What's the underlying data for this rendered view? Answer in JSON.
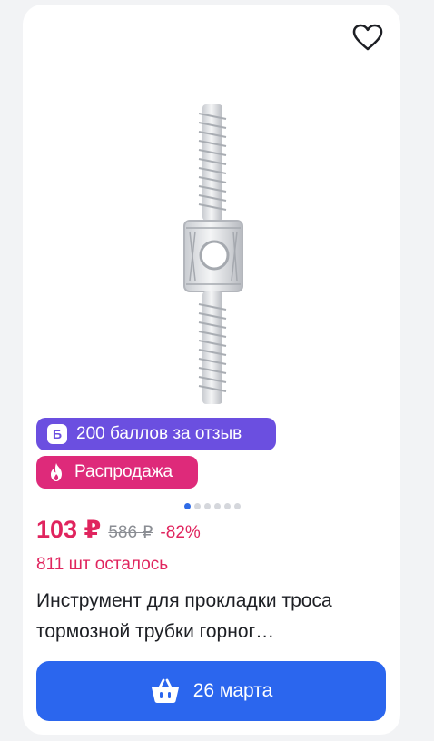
{
  "card": {
    "badges": {
      "points_icon": "Б",
      "points_label": "200 баллов за отзыв",
      "sale_label": "Распродажа"
    },
    "gallery": {
      "total_images": 6,
      "active_index": 0
    },
    "price": {
      "current": "103 ₽",
      "old": "586 ₽",
      "discount": "-82%"
    },
    "stock": "811 шт осталось",
    "title": "Инструмент для прокладки троса тормозной трубки горног…",
    "delivery_button": {
      "label": "26 марта"
    },
    "icons": [
      "heart-icon",
      "basket-icon",
      "fire-icon"
    ],
    "colors": {
      "accent": "#2b66ee",
      "price": "#e0245e",
      "points_badge": "#6b4fe0",
      "sale_badge": "#de2a7a"
    }
  }
}
